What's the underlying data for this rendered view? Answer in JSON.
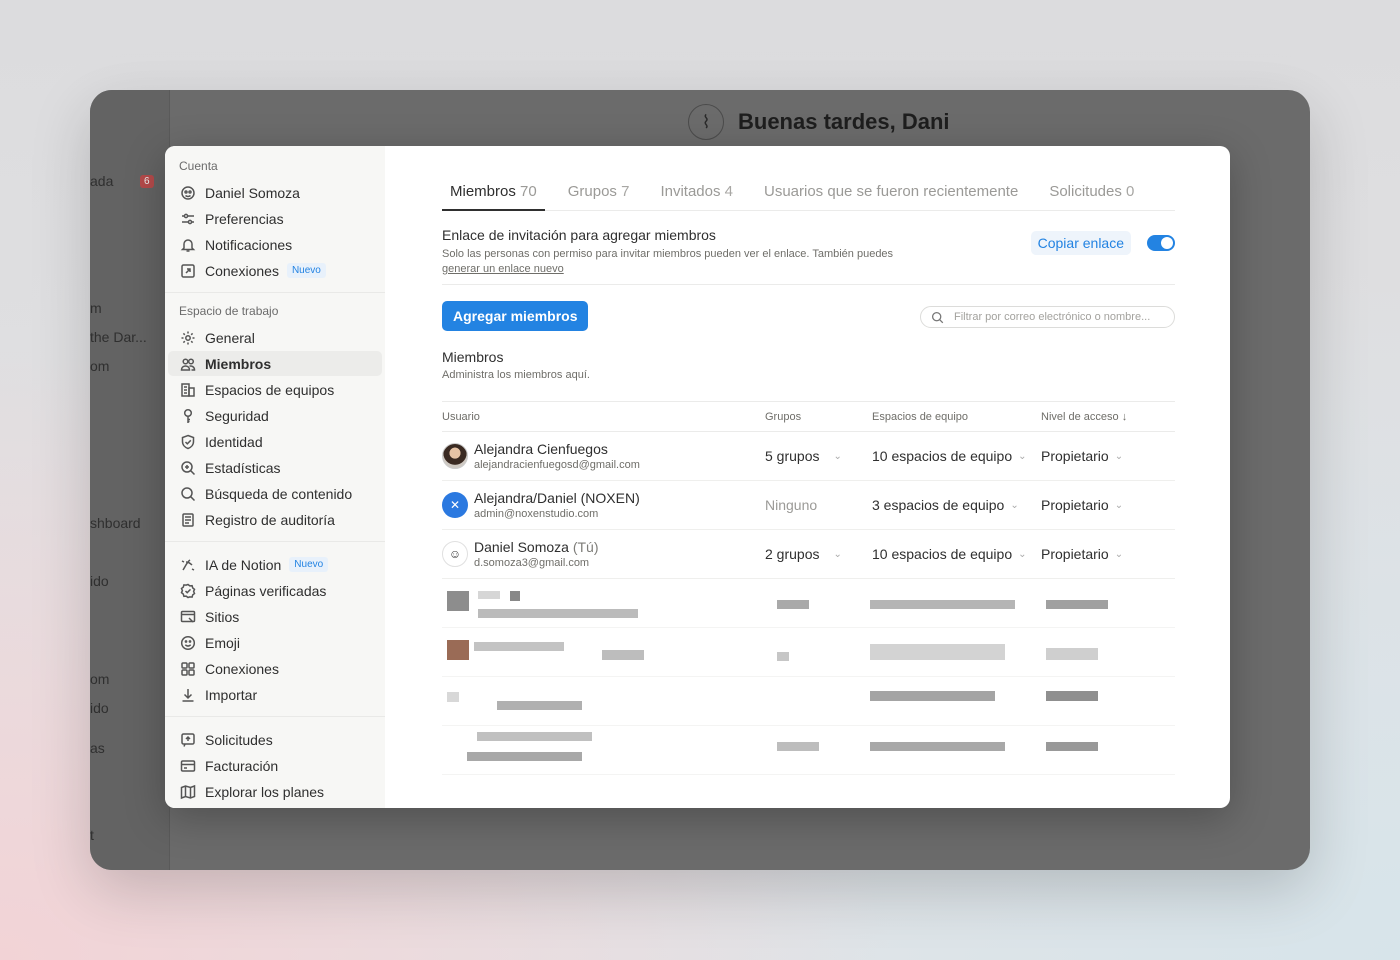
{
  "background": {
    "greeting": "Buenas tardes, Dani",
    "sidebar_fragments": [
      "ada",
      "m",
      " the Dar...",
      "om",
      "shboard",
      "ido",
      "om",
      "ido",
      "as",
      "t"
    ],
    "badge": "6"
  },
  "sidebar": {
    "account_label": "Cuenta",
    "account_items": [
      {
        "label": "Daniel Somoza",
        "icon": "avatar-icon"
      },
      {
        "label": "Preferencias",
        "icon": "sliders-icon"
      },
      {
        "label": "Notificaciones",
        "icon": "bell-icon"
      },
      {
        "label": "Conexiones",
        "icon": "external-link-icon",
        "tag": "Nuevo"
      }
    ],
    "workspace_label": "Espacio de trabajo",
    "workspace_items": [
      {
        "label": "General",
        "icon": "gear-icon"
      },
      {
        "label": "Miembros",
        "icon": "people-icon",
        "active": true
      },
      {
        "label": "Espacios de equipos",
        "icon": "building-icon"
      },
      {
        "label": "Seguridad",
        "icon": "key-icon"
      },
      {
        "label": "Identidad",
        "icon": "shield-check-icon"
      },
      {
        "label": "Estadísticas",
        "icon": "zoom-in-icon"
      },
      {
        "label": "Búsqueda de contenido",
        "icon": "search-icon"
      },
      {
        "label": "Registro de auditoría",
        "icon": "audit-log-icon"
      }
    ],
    "features_items": [
      {
        "label": "IA de Notion",
        "icon": "notion-ai-icon",
        "tag": "Nuevo"
      },
      {
        "label": "Páginas verificadas",
        "icon": "verified-badge-icon"
      },
      {
        "label": "Sitios",
        "icon": "site-icon"
      },
      {
        "label": "Emoji",
        "icon": "smiley-icon"
      },
      {
        "label": "Conexiones",
        "icon": "grid-icon"
      },
      {
        "label": "Importar",
        "icon": "download-icon"
      }
    ],
    "billing_items": [
      {
        "label": "Solicitudes",
        "icon": "request-icon"
      },
      {
        "label": "Facturación",
        "icon": "credit-card-icon"
      },
      {
        "label": "Explorar los planes",
        "icon": "map-icon"
      }
    ]
  },
  "tabs": [
    {
      "label": "Miembros",
      "count": "70",
      "active": true
    },
    {
      "label": "Grupos",
      "count": "7"
    },
    {
      "label": "Invitados",
      "count": "4"
    },
    {
      "label": "Usuarios que se fueron recientemente",
      "count": ""
    },
    {
      "label": "Solicitudes",
      "count": "0"
    }
  ],
  "invite": {
    "title": "Enlace de invitación para agregar miembros",
    "desc": "Solo las personas con permiso para invitar miembros pueden ver el enlace. También puedes",
    "link": "generar un enlace nuevo",
    "copy_label": "Copiar enlace",
    "enabled": true
  },
  "actions": {
    "add_label": "Agregar miembros",
    "search_placeholder": "Filtrar por correo electrónico o nombre..."
  },
  "members": {
    "title": "Miembros",
    "subtitle": "Administra los miembros aquí.",
    "columns": {
      "user": "Usuario",
      "groups": "Grupos",
      "spaces": "Espacios de equipo",
      "access": "Nivel de acceso ↓"
    },
    "rows": [
      {
        "name": "Alejandra Cienfuegos",
        "you": "",
        "email": "alejandracienfuegosd@gmail.com",
        "groups": "5 grupos",
        "groups_dropdown": true,
        "spaces": "10 espacios de equipo",
        "access": "Propietario",
        "avatar": "photo"
      },
      {
        "name": "Alejandra/Daniel (NOXEN)",
        "you": "",
        "email": "admin@noxenstudio.com",
        "groups": "Ninguno",
        "groups_dropdown": false,
        "spaces": "3 espacios de equipo",
        "access": "Propietario",
        "avatar": "logo"
      },
      {
        "name": "Daniel Somoza",
        "you": "(Tú)",
        "email": "d.somoza3@gmail.com",
        "groups": "2 grupos",
        "groups_dropdown": true,
        "spaces": "10 espacios de equipo",
        "access": "Propietario",
        "avatar": "sketch"
      }
    ]
  },
  "colors": {
    "accent": "#2383e2",
    "sidebar_bg": "#f7f7f5"
  }
}
